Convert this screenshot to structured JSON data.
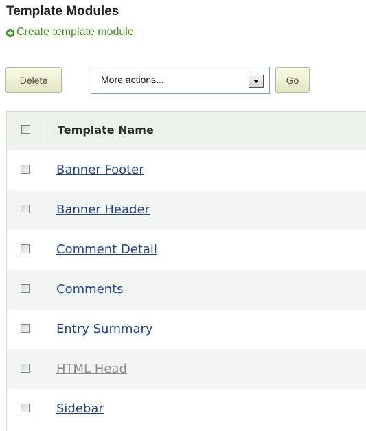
{
  "header": {
    "title": "Template Modules",
    "create_link": "Create template module"
  },
  "toolbar": {
    "delete_label": "Delete",
    "actions_select_value": "More actions...",
    "go_label": "Go"
  },
  "table": {
    "column_header": "Template Name",
    "rows": [
      {
        "name": "Banner Footer"
      },
      {
        "name": "Banner Header"
      },
      {
        "name": "Comment Detail"
      },
      {
        "name": "Comments"
      },
      {
        "name": "Entry Summary"
      },
      {
        "name": "HTML Head"
      },
      {
        "name": "Sidebar"
      }
    ]
  },
  "colors": {
    "link": "#22458a",
    "link_muted": "#8c8c8c",
    "create_link": "#4f8a2c",
    "header_bg": "#eef2ec",
    "alt_row_bg": "#f3f5f3"
  },
  "icons": {
    "create": "plus-circle-icon",
    "select_arrow": "chevron-down-icon"
  }
}
